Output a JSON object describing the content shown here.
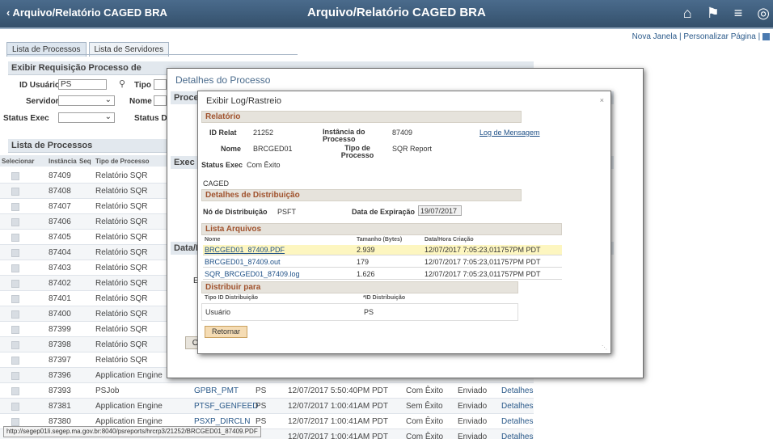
{
  "banner": {
    "back_label": "Arquivo/Relatório CAGED BRA",
    "title": "Arquivo/Relatório CAGED BRA",
    "icons": [
      "home-icon",
      "flag-icon",
      "menu-icon",
      "compass-icon"
    ]
  },
  "top_links": {
    "new_window": "Nova Janela",
    "sep": "|",
    "personalize": "Personalizar Página",
    "sep2": "|"
  },
  "tabs": [
    {
      "label": "Lista de Processos"
    },
    {
      "label": "Lista de Servidores"
    }
  ],
  "request": {
    "header": "Exibir Requisição Processo de",
    "id_user_label": "ID Usuário",
    "id_user_value": "PS",
    "type_label": "Tipo",
    "server_label": "Servidor",
    "name_label": "Nome",
    "status_exec_label": "Status Exec",
    "status_di_label": "Status Di"
  },
  "process_list": {
    "header": "Lista de Processos",
    "columns": [
      "Selecionar",
      "Instância",
      "Seq",
      "Tipo de Processo"
    ],
    "rows": [
      {
        "inst": "87409",
        "type": "Relatório SQR"
      },
      {
        "inst": "87408",
        "type": "Relatório SQR"
      },
      {
        "inst": "87407",
        "type": "Relatório SQR"
      },
      {
        "inst": "87406",
        "type": "Relatório SQR"
      },
      {
        "inst": "87405",
        "type": "Relatório SQR"
      },
      {
        "inst": "87404",
        "type": "Relatório SQR"
      },
      {
        "inst": "87403",
        "type": "Relatório SQR"
      },
      {
        "inst": "87402",
        "type": "Relatório SQR"
      },
      {
        "inst": "87401",
        "type": "Relatório SQR"
      },
      {
        "inst": "87400",
        "type": "Relatório SQR"
      },
      {
        "inst": "87399",
        "type": "Relatório SQR"
      },
      {
        "inst": "87398",
        "type": "Relatório SQR"
      },
      {
        "inst": "87397",
        "type": "Relatório SQR"
      },
      {
        "inst": "87396",
        "type": "Application Engine"
      },
      {
        "inst": "87393",
        "type": "PSJob",
        "name": "GPBR_PMT",
        "user": "PS",
        "date": "12/07/2017  5:50:40PM PDT",
        "status": "Com Êxito",
        "dist": "Enviado",
        "detail": "Detalhes"
      },
      {
        "inst": "87381",
        "type": "Application Engine",
        "name": "PTSF_GENFEED",
        "user": "PS",
        "date": "12/07/2017  1:00:41AM PDT",
        "status": "Sem Êxito",
        "dist": "Enviado",
        "detail": "Detalhes"
      },
      {
        "inst": "87380",
        "type": "Application Engine",
        "name": "PSXP_DIRCLN",
        "user": "PS",
        "date": "12/07/2017  1:00:41AM PDT",
        "status": "Com Êxito",
        "dist": "Enviado",
        "detail": "Detalhes"
      },
      {
        "inst": "",
        "type": "",
        "name": "",
        "user": "",
        "date": "12/07/2017  1:00:41AM PDT",
        "status": "Com Êxito",
        "dist": "Enviado",
        "detail": "Detalhes"
      }
    ]
  },
  "detail_modal": {
    "title": "Detalhes do Processo",
    "sec_proc": "Proce",
    "sec_exec": "Exec",
    "sec_data": "Data/H",
    "e_label": "E",
    "ok_label": "OK"
  },
  "log_modal": {
    "title": "Exibir Log/Rastreio",
    "close": "×",
    "report_section": "Relatório",
    "id_relat_label": "ID Relat",
    "id_relat_value": "21252",
    "instance_label": "Instância do Processo",
    "instance_value": "87409",
    "message_log_link": "Log de Mensagem",
    "name_label": "Nome",
    "name_value": "BRCGED01",
    "proc_type_label": "Tipo de Processo",
    "proc_type_value": "SQR Report",
    "status_label": "Status Exec",
    "status_value": "Com Êxito",
    "caged_text": "CAGED",
    "dist_section": "Detalhes de Distribuição",
    "dist_node_label": "Nó de Distribuição",
    "dist_node_value": "PSFT",
    "expire_label": "Data de Expiração",
    "expire_value": "19/07/2017",
    "files_section": "Lista Arquivos",
    "files_cols": [
      "Nome",
      "Tamanho (Bytes)",
      "Data/Hora Criação"
    ],
    "files": [
      {
        "name": "BRCGED01_87409.PDF",
        "size": "2.939",
        "date": "12/07/2017  7:05:23,011757PM PDT"
      },
      {
        "name": "BRCGED01_87409.out",
        "size": "179",
        "date": "12/07/2017  7:05:23,011757PM PDT"
      },
      {
        "name": "SQR_BRCGED01_87409.log",
        "size": "1.626",
        "date": "12/07/2017  7:05:23,011757PM PDT"
      }
    ],
    "distribute_section": "Distribuir para",
    "dist_cols": [
      "Tipo ID Distribuição",
      "*ID Distribuição"
    ],
    "dist_type": "Usuário",
    "dist_id": "PS",
    "return_label": "Retornar"
  },
  "status_bar": "http://segep01li.segep.ma.gov.br:8040/psreports/hrcrp3/21252/BRCGED01_87409.PDF"
}
